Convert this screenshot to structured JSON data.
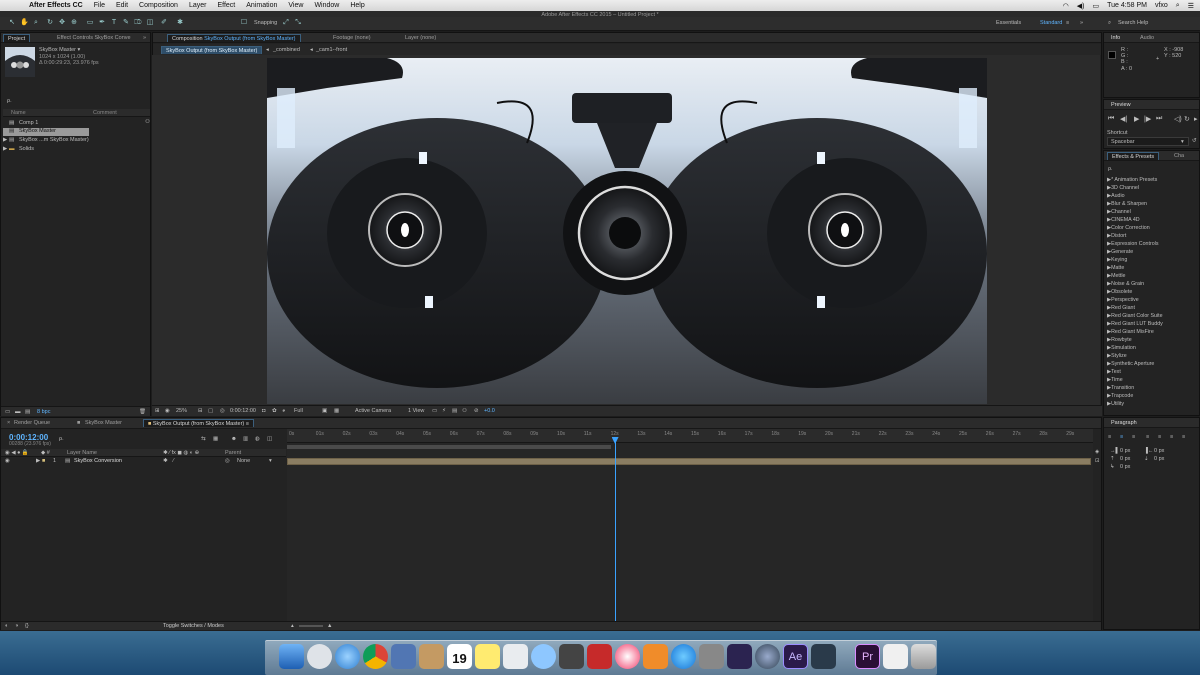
{
  "menubar": {
    "app": "After Effects CC",
    "items": [
      "File",
      "Edit",
      "Composition",
      "Layer",
      "Effect",
      "Animation",
      "View",
      "Window",
      "Help"
    ],
    "clock": "Tue 4:58 PM",
    "user": "vfxo"
  },
  "window_title": "Adobe After Effects CC 2015 – Untitled Project *",
  "toolbar": {
    "snapping_label": "Snapping",
    "workspace_essentials": "Essentials",
    "workspace_standard": "Standard",
    "search_help": "Search Help"
  },
  "project": {
    "tab_project": "Project",
    "tab_effect_controls": "Effect Controls SkyBox Conve",
    "comp_name": "SkyBox Master ▾",
    "comp_size": "1024 x 1024 (1.00)",
    "comp_duration": "Δ 0:00:29:23, 23.976 fps",
    "search_glyph": "ρ.",
    "col_name": "Name",
    "col_comment": "Comment",
    "items": [
      "Comp 1",
      "SkyBox Master",
      "SkyBox ...m SkyBox Master)",
      "Solids"
    ],
    "bpc": "8 bpc"
  },
  "composition": {
    "tab_label": "Composition",
    "tab_name": "SkyBox Output (from SkyBox Master)",
    "footage_tab": "Footage (none)",
    "layer_tab": "Layer (none)",
    "flow": [
      "SkyBox Output (from SkyBox Master)",
      "_combined",
      "_cam1--front"
    ],
    "zoom": "25%",
    "timecode": "0:00:12:00",
    "resolution": "Full",
    "camera": "Active Camera",
    "views": "1 View",
    "exposure": "+0.0"
  },
  "info": {
    "tab_info": "Info",
    "tab_audio": "Audio",
    "r": "R :",
    "g": "G :",
    "b": "B :",
    "a": "A : 0",
    "x": "X : -908",
    "y": "Y : 520"
  },
  "preview": {
    "tab": "Preview",
    "shortcut_label": "Shortcut",
    "shortcut_value": "Spacebar"
  },
  "effects": {
    "tab": "Effects & Presets",
    "tab2": "Cha",
    "search_glyph": "ρ.",
    "items": [
      "* Animation Presets",
      "3D Channel",
      "Audio",
      "Blur & Sharpen",
      "Channel",
      "CINEMA 4D",
      "Color Correction",
      "Distort",
      "Expression Controls",
      "Generate",
      "Keying",
      "Matte",
      "Mettle",
      "Noise & Grain",
      "Obsolete",
      "Perspective",
      "Red Giant",
      "Red Giant Color Suite",
      "Red Giant LUT Buddy",
      "Red Giant MisFire",
      "Rowbyte",
      "Simulation",
      "Stylize",
      "Synthetic Aperture",
      "Text",
      "Time",
      "Transition",
      "Trapcode",
      "Utility"
    ]
  },
  "timeline": {
    "tab_render": "Render Queue",
    "tab_skybox_master": "SkyBox Master",
    "tab_output": "SkyBox Output (from SkyBox Master)",
    "timecode": "0:00:12:00",
    "frames": "00288 (23.976 fps)",
    "col_layer_name": "Layer Name",
    "col_parent": "Parent",
    "layer_number": "1",
    "layer_name": "SkyBox Conversion",
    "layer_parent": "None",
    "ruler": [
      "0s",
      "01s",
      "02s",
      "03s",
      "04s",
      "05s",
      "06s",
      "07s",
      "08s",
      "09s",
      "10s",
      "11s",
      "12s",
      "13s",
      "14s",
      "15s",
      "16s",
      "17s",
      "18s",
      "19s",
      "20s",
      "21s",
      "22s",
      "23s",
      "24s",
      "25s",
      "26s",
      "27s",
      "28s",
      "29s"
    ],
    "playhead_time": 12,
    "toggle_label": "Toggle Switches / Modes"
  },
  "paragraph": {
    "tab": "Paragraph",
    "v1": "0 px",
    "v2": "0 px",
    "v3": "0 px",
    "v4": "0 px",
    "v5": "0 px"
  },
  "dock": {
    "calendar_day": "19",
    "ae_label": "Ae",
    "pr_label": "Pr"
  }
}
